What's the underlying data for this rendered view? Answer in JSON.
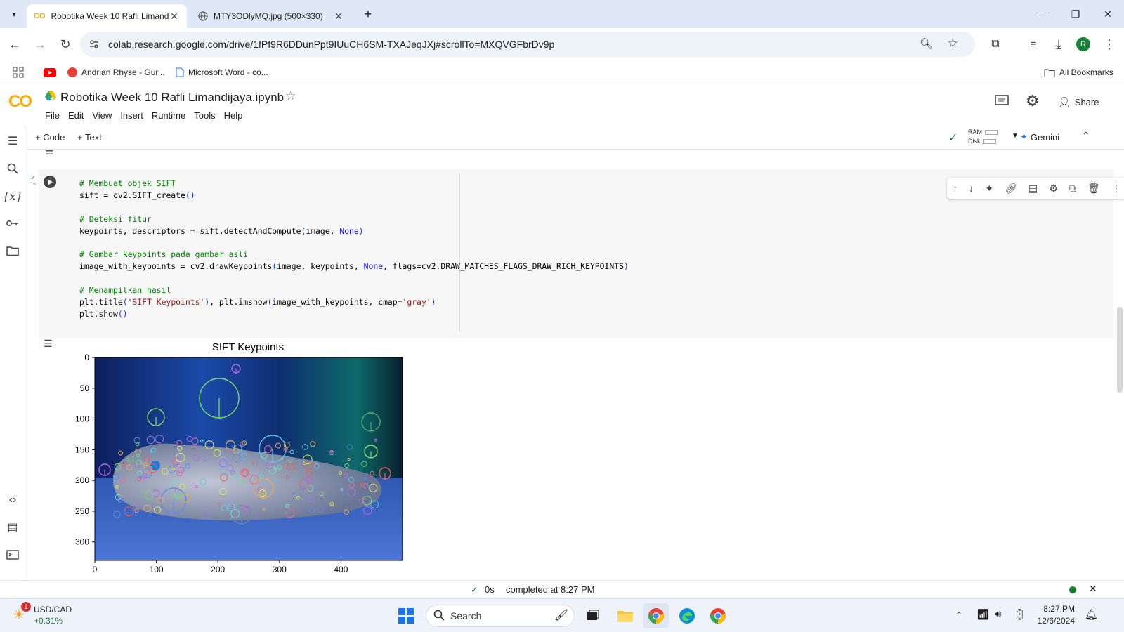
{
  "browser": {
    "tabs": [
      {
        "title": "Robotika Week 10 Rafli Limandi",
        "active": true
      },
      {
        "title": "MTY3ODlyMQ.jpg (500×330)",
        "active": false
      }
    ],
    "url": "colab.research.google.com/drive/1fPf9R6DDunPpt9IUuCH6SM-TXAJeqJXj#scrollTo=MXQVGFbrDv9p",
    "profile_initial": "R",
    "bookmarks": [
      "Andrian Rhyse - Gur...",
      "Microsoft Word - co..."
    ],
    "all_bookmarks_label": "All Bookmarks"
  },
  "colab": {
    "logo": "CO",
    "notebook_title": "Robotika Week 10 Rafli Limandijaya.ipynb",
    "menu": [
      "File",
      "Edit",
      "View",
      "Insert",
      "Runtime",
      "Tools",
      "Help"
    ],
    "share_label": "Share",
    "add_code_label": "Code",
    "add_text_label": "Text",
    "ram_label": "RAM",
    "disk_label": "Disk",
    "gemini_label": "Gemini",
    "exec_time_label": "1s"
  },
  "code_lines": [
    "# Membuat objek SIFT",
    "sift = cv2.SIFT_create()",
    "",
    "# Deteksi fitur",
    "keypoints, descriptors = sift.detectAndCompute(image, None)",
    "",
    "# Gambar keypoints pada gambar asli",
    "image_with_keypoints = cv2.drawKeypoints(image, keypoints, None, flags=cv2.DRAW_MATCHES_FLAGS_DRAW_RICH_KEYPOINTS)",
    "",
    "# Menampilkan hasil",
    "plt.title('SIFT Keypoints'), plt.imshow(image_with_keypoints, cmap='gray')",
    "plt.show()"
  ],
  "chart_data": {
    "type": "image",
    "title": "SIFT Keypoints",
    "y_ticks": [
      "0",
      "50",
      "100",
      "150",
      "200",
      "250",
      "300"
    ],
    "x_ticks": [
      "0",
      "100",
      "200",
      "300",
      "400"
    ],
    "xlim": [
      0,
      500
    ],
    "ylim": [
      330,
      0
    ]
  },
  "status": {
    "duration": "0s",
    "completed": "completed at 8:27 PM"
  },
  "taskbar": {
    "widget_title": "USD/CAD",
    "widget_value": "+0.31%",
    "widget_badge": "1",
    "search_label": "Search",
    "time": "8:27 PM",
    "date": "12/6/2024"
  },
  "colors": {
    "accent": "#1a73e8",
    "colab_orange": "#f9ab00",
    "ok_green": "#188038"
  }
}
